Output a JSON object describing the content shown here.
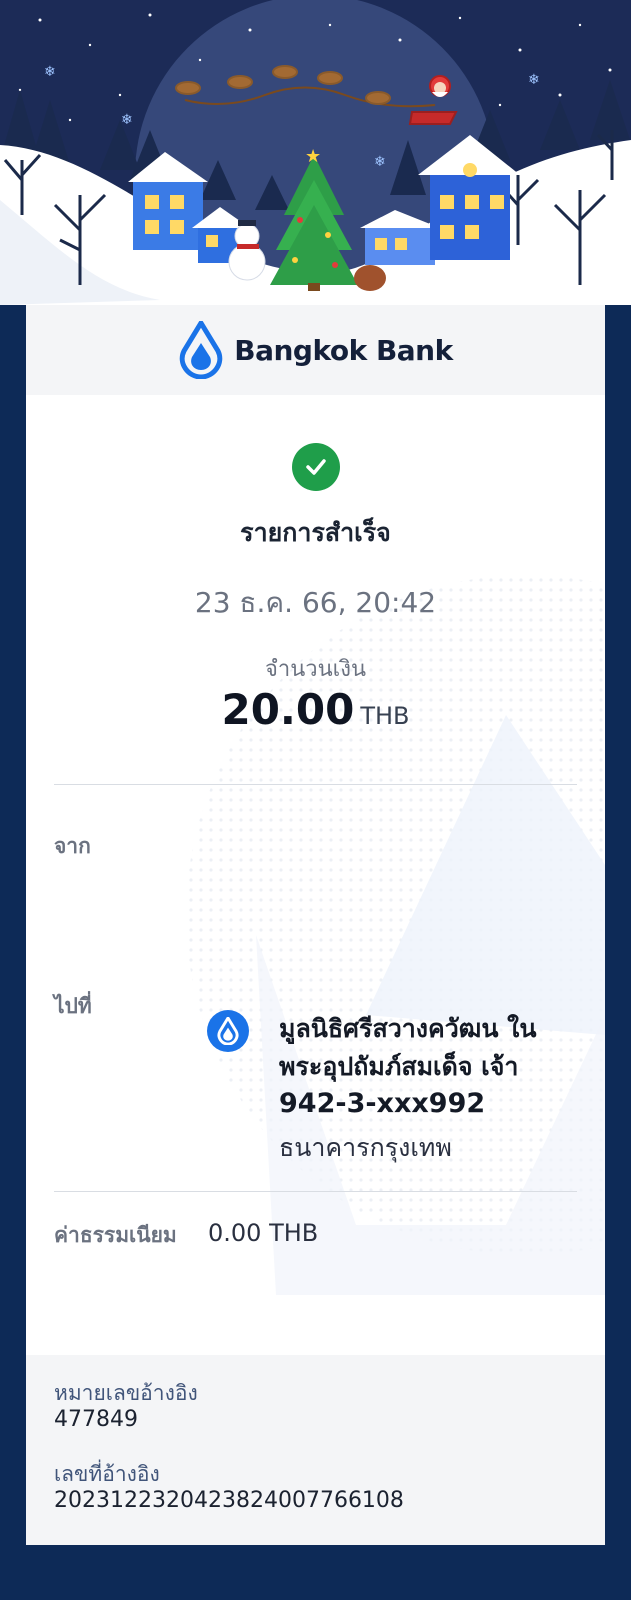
{
  "brand": {
    "name": "Bangkok Bank",
    "color": "#1a73e8"
  },
  "receipt": {
    "status": "รายการสำเร็จ",
    "datetime": "23 ธ.ค. 66, 20:42",
    "amount_label": "จำนวนเงิน",
    "amount": "20.00",
    "currency": "THB",
    "from_label": "จาก",
    "to_label": "ไปที่",
    "to": {
      "name": "มูลนิธิศรีสวางควัฒน ในพระอุปถัมภ์สมเด็จ เจ้า",
      "account": "942-3-xxx992",
      "bank": "ธนาคารกรุงเทพ",
      "icon": "bangkok-bank-icon"
    },
    "fee_label": "ค่าธรรมเนียม",
    "fee": "0.00 THB",
    "reference_label": "หมายเลขอ้างอิง",
    "reference": "477849",
    "ref_no_label": "เลขที่อ้างอิง",
    "ref_no": "2023122320423824007766108"
  },
  "colors": {
    "success": "#1f9e4a",
    "page_bg": "#0d2a57"
  },
  "banner": {
    "theme": "christmas-village"
  }
}
